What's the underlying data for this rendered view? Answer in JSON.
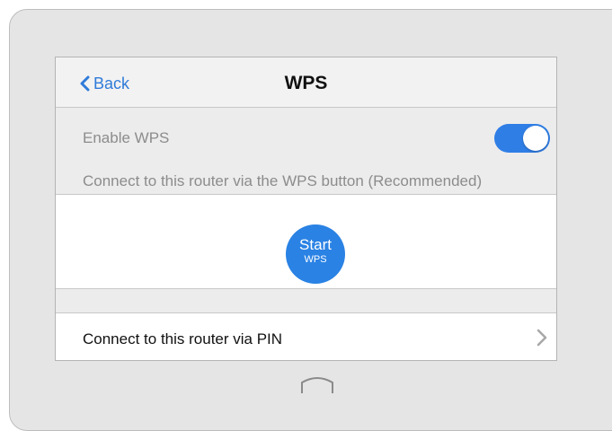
{
  "nav": {
    "back_label": "Back",
    "title": "WPS"
  },
  "wps": {
    "enable_label": "Enable WPS",
    "enabled": true,
    "button_section_label": "Connect to this router via the WPS button (Recommended)",
    "start_button_main": "Start",
    "start_button_sub": "WPS"
  },
  "pin": {
    "label": "Connect to this router via PIN"
  },
  "icons": {
    "back": "chevron-left-icon",
    "pin": "chevron-right-icon",
    "home": "home-button-icon"
  },
  "colors": {
    "accent": "#2f7bd9",
    "toggle_on": "#2f7ee6",
    "start_button": "#2a82e4"
  }
}
